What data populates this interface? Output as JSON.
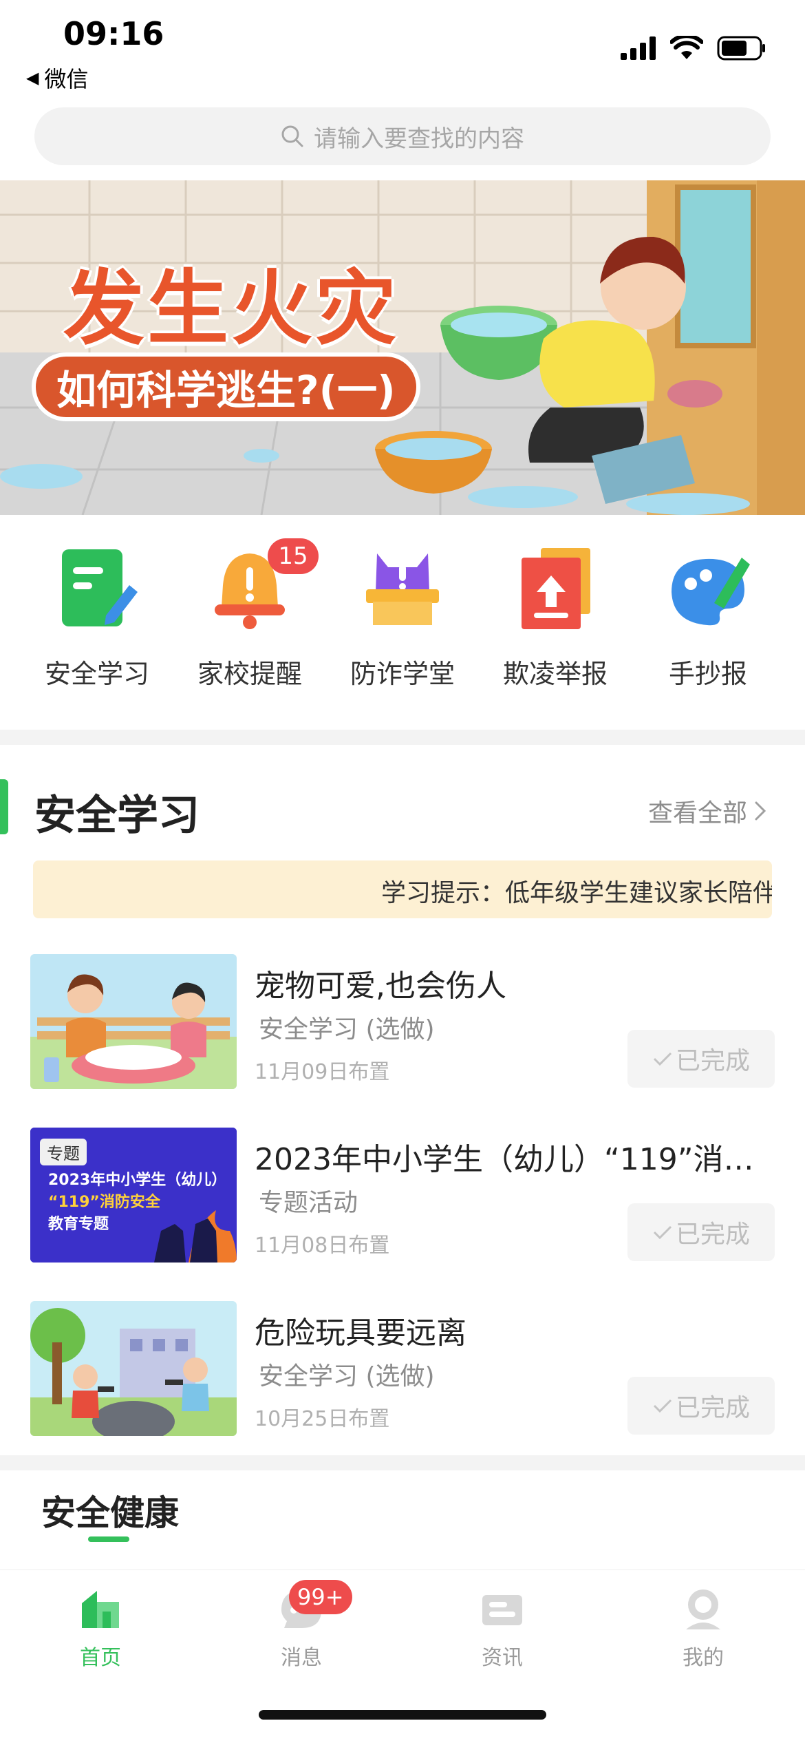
{
  "status_bar": {
    "time": "09:16",
    "back_label": "微信"
  },
  "search": {
    "placeholder": "请输入要查找的内容"
  },
  "banner": {
    "title": "发生火灾",
    "subtitle": "如何科学逃生?(一)"
  },
  "quick_menu": [
    {
      "label": "安全学习",
      "icon": "safety-study-icon"
    },
    {
      "label": "家校提醒",
      "icon": "bell-icon",
      "badge": "15"
    },
    {
      "label": "防诈学堂",
      "icon": "anti-fraud-icon"
    },
    {
      "label": "欺凌举报",
      "icon": "report-icon"
    },
    {
      "label": "手抄报",
      "icon": "palette-icon"
    }
  ],
  "section": {
    "title": "安全学习",
    "see_all": "查看全部",
    "tip": "学习提示：低年级学生建议家长陪伴"
  },
  "items": [
    {
      "title": "宠物可爱,也会伤人",
      "type": "安全学习 (选做)",
      "date": "11月09日布置",
      "status": "已完成"
    },
    {
      "title": "2023年中小学生（幼儿）“119”消防…",
      "type": "专题活动",
      "date": "11月08日布置",
      "status": "已完成",
      "thumb_tag": "专题",
      "thumb_lines": [
        "2023年中小学生（幼儿）",
        "“119”消防安全",
        "教育专题"
      ]
    },
    {
      "title": "危险玩具要远离",
      "type": "安全学习 (选做)",
      "date": "10月25日布置",
      "status": "已完成"
    }
  ],
  "section2": {
    "title": "安全健康"
  },
  "tabs": [
    {
      "label": "首页",
      "active": true
    },
    {
      "label": "消息",
      "badge": "99+"
    },
    {
      "label": "资讯"
    },
    {
      "label": "我的"
    }
  ],
  "colors": {
    "accent": "#34c05b",
    "badge": "#ee4c4c",
    "tip_bg": "#fdf0d3"
  }
}
